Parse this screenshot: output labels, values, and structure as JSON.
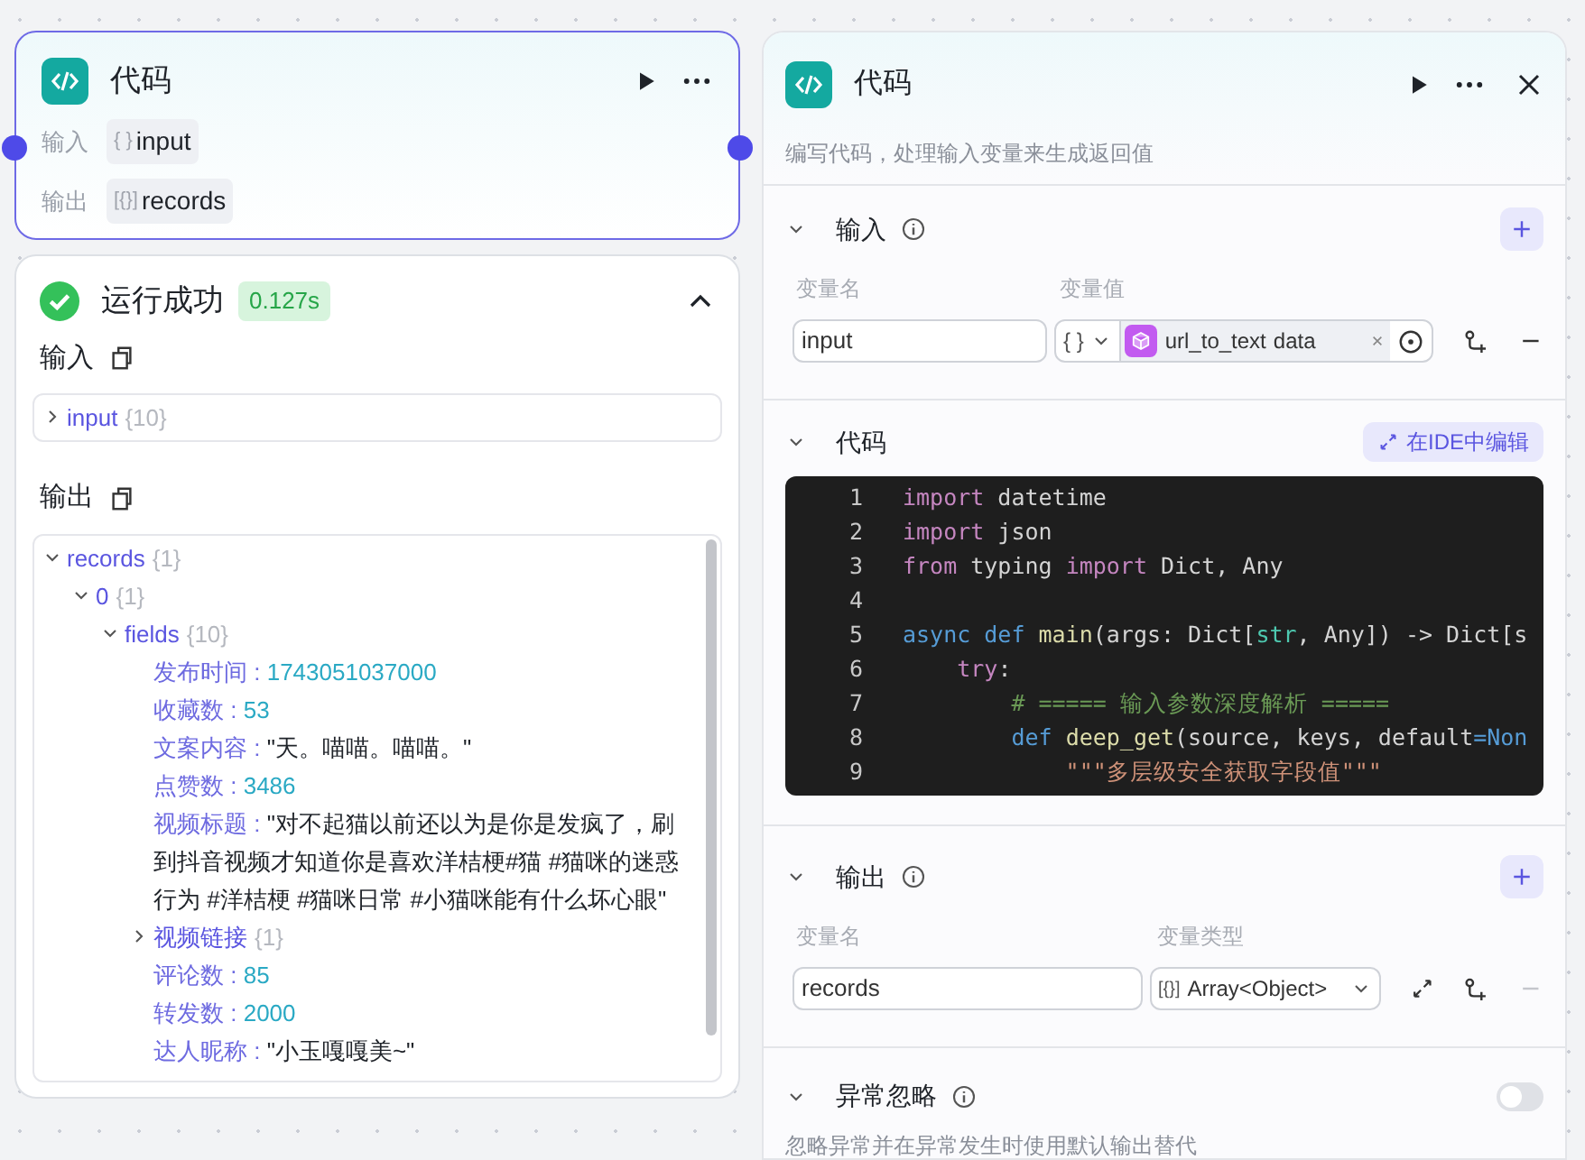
{
  "node_card": {
    "title": "代码",
    "rows": [
      {
        "label": "输入",
        "type_icon": "{ }",
        "value": "input"
      },
      {
        "label": "输出",
        "type_icon": "[{}]",
        "value": "records"
      }
    ]
  },
  "run_result": {
    "status": "运行成功",
    "duration": "0.127s",
    "expanded": true,
    "input_section": {
      "title": "输入",
      "tree": [
        {
          "key": "input",
          "count": "{10}",
          "expanded": false,
          "kind": "object"
        }
      ]
    },
    "output_section": {
      "title": "输出",
      "tree": [
        {
          "key": "records",
          "count": "{1}",
          "expanded": true,
          "kind": "object",
          "children": [
            {
              "key": "0",
              "count": "{1}",
              "expanded": true,
              "kind": "object",
              "children": [
                {
                  "key": "fields",
                  "count": "{10}",
                  "expanded": true,
                  "kind": "object",
                  "children": [
                    {
                      "key": "发布时间 :",
                      "value": "1743051037000",
                      "kind": "number"
                    },
                    {
                      "key": "收藏数 :",
                      "value": "53",
                      "kind": "number"
                    },
                    {
                      "key": "文案内容 :",
                      "value": "\"天。喵喵。喵喵。\"",
                      "kind": "string"
                    },
                    {
                      "key": "点赞数 :",
                      "value": "3486",
                      "kind": "number"
                    },
                    {
                      "key": "视频标题 :",
                      "value": "\"对不起猫以前还以为是你是发疯了，刷到抖音视频才知道你是喜欢洋桔梗#猫 #猫咪的迷惑行为 #洋桔梗 #猫咪日常 #小猫咪能有什么坏心眼\"",
                      "kind": "string"
                    },
                    {
                      "key": "视频链接",
                      "count": "{1}",
                      "expanded": false,
                      "kind": "object"
                    },
                    {
                      "key": "评论数 :",
                      "value": "85",
                      "kind": "number"
                    },
                    {
                      "key": "转发数 :",
                      "value": "2000",
                      "kind": "number"
                    },
                    {
                      "key": "达人昵称 :",
                      "value": "\"小玉嘎嘎美~\"",
                      "kind": "string"
                    }
                  ]
                }
              ]
            }
          ]
        }
      ]
    }
  },
  "side_panel": {
    "title": "代码",
    "description": "编写代码，处理输入变量来生成返回值",
    "input_section": {
      "title": "输入",
      "col_name": "变量名",
      "col_value": "变量值",
      "rows": [
        {
          "name": "input",
          "type_icon": "{ }",
          "ref_node": "url_to_text",
          "ref_field": "data"
        }
      ]
    },
    "code_section": {
      "title": "代码",
      "edit_button": "在IDE中编辑",
      "lines": [
        {
          "number": "1",
          "tokens": [
            {
              "text": "import",
              "kind": "keyword"
            },
            {
              "text": " datetime",
              "kind": "plain"
            }
          ]
        },
        {
          "number": "2",
          "tokens": [
            {
              "text": "import",
              "kind": "keyword"
            },
            {
              "text": " json",
              "kind": "plain"
            }
          ]
        },
        {
          "number": "3",
          "tokens": [
            {
              "text": "from",
              "kind": "keyword"
            },
            {
              "text": " typing ",
              "kind": "plain"
            },
            {
              "text": "import",
              "kind": "keyword"
            },
            {
              "text": " Dict, Any",
              "kind": "plain"
            }
          ]
        },
        {
          "number": "4"
        },
        {
          "number": "5",
          "tokens": [
            {
              "text": "async def",
              "kind": "storage"
            },
            {
              "text": " main",
              "kind": "func"
            },
            {
              "text": "(args: Dict[",
              "kind": "plain"
            },
            {
              "text": "str",
              "kind": "builtin"
            },
            {
              "text": ", Any]) -> Dict[s",
              "kind": "plain"
            }
          ]
        },
        {
          "number": "6",
          "tokens": [
            {
              "text": "    try",
              "kind": "keyword"
            },
            {
              "text": ":",
              "kind": "plain"
            }
          ]
        },
        {
          "number": "7",
          "tokens": [
            {
              "text": "        # ===== 输入参数深度解析 =====",
              "kind": "comment"
            }
          ]
        },
        {
          "number": "8",
          "tokens": [
            {
              "text": "        def",
              "kind": "storage"
            },
            {
              "text": " deep_get",
              "kind": "func"
            },
            {
              "text": "(source, keys, default",
              "kind": "plain"
            },
            {
              "text": "=Non",
              "kind": "storage"
            }
          ]
        },
        {
          "number": "9",
          "tokens": [
            {
              "text": "            \"\"\"多层级安全获取字段值\"\"\"",
              "kind": "string"
            }
          ]
        }
      ]
    },
    "output_section": {
      "title": "输出",
      "col_name": "变量名",
      "col_type": "变量类型",
      "rows": [
        {
          "name": "records",
          "type_icon": "[{}]",
          "type": "Array<Object>"
        }
      ]
    },
    "error_section": {
      "title": "异常忽略",
      "description": "忽略异常并在异常发生时使用默认输出替代",
      "on": false
    }
  }
}
